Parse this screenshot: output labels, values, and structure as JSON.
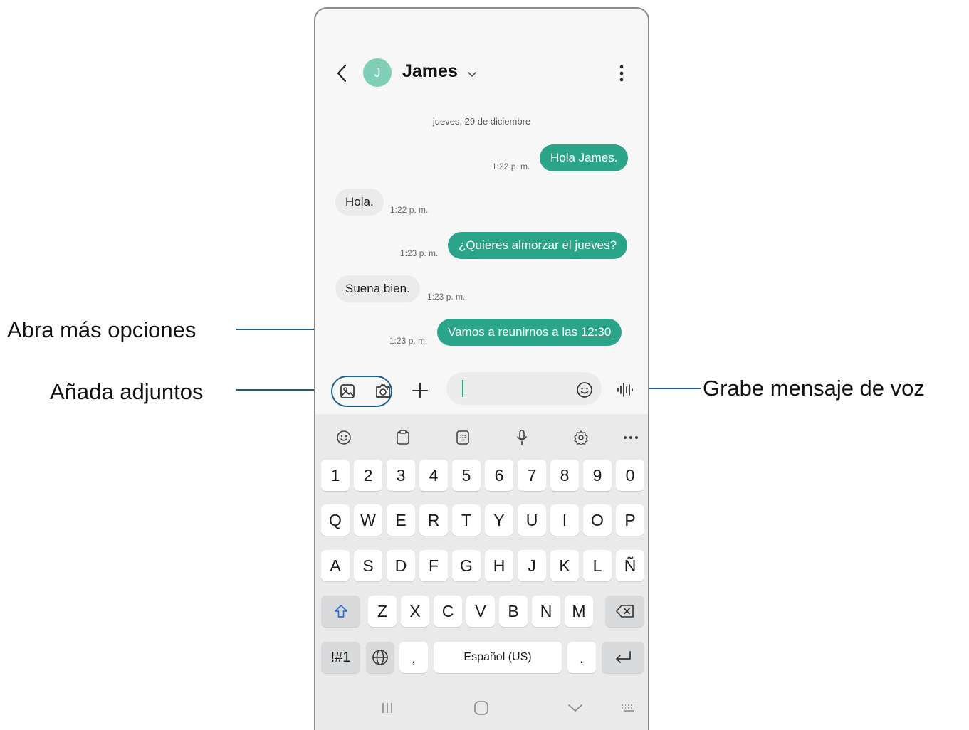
{
  "callouts": {
    "more_options": "Abra más opciones",
    "attachments": "Añada adjuntos",
    "voice": "Grabe mensaje de voz"
  },
  "header": {
    "avatar_initial": "J",
    "contact_name": "James",
    "back_icon": "chevron-left-icon",
    "menu_icon": "more-vertical-icon"
  },
  "conversation": {
    "date": "jueves, 29 de diciembre",
    "messages": [
      {
        "dir": "out",
        "text": "Hola James.",
        "time": "1:22 p. m."
      },
      {
        "dir": "in",
        "text": "Hola.",
        "time": "1:22 p. m."
      },
      {
        "dir": "out",
        "text": "¿Quieres almorzar el jueves?",
        "time": "1:23 p. m."
      },
      {
        "dir": "in",
        "text": "Suena bien.",
        "time": "1:23 p. m."
      },
      {
        "dir": "out",
        "text_before": "Vamos a reunirnos a las ",
        "text_link": "12:30",
        "time": "1:23 p. m."
      }
    ]
  },
  "composer": {
    "accent": "#2aa58a",
    "input_value": ""
  },
  "keyboard": {
    "toolbar_icons": [
      "emoji-icon",
      "clipboard-icon",
      "keypad-icon",
      "microphone-icon",
      "settings-icon",
      "more-horizontal-icon"
    ],
    "row_numbers": [
      "1",
      "2",
      "3",
      "4",
      "5",
      "6",
      "7",
      "8",
      "9",
      "0"
    ],
    "row_q": [
      "Q",
      "W",
      "E",
      "R",
      "T",
      "Y",
      "U",
      "I",
      "O",
      "P"
    ],
    "row_a": [
      "A",
      "S",
      "D",
      "F",
      "G",
      "H",
      "J",
      "K",
      "L",
      "Ñ"
    ],
    "row_z": [
      "Z",
      "X",
      "C",
      "V",
      "B",
      "N",
      "M"
    ],
    "symbols": "!#1",
    "comma": ",",
    "space": "Español (US)",
    "period": "."
  }
}
